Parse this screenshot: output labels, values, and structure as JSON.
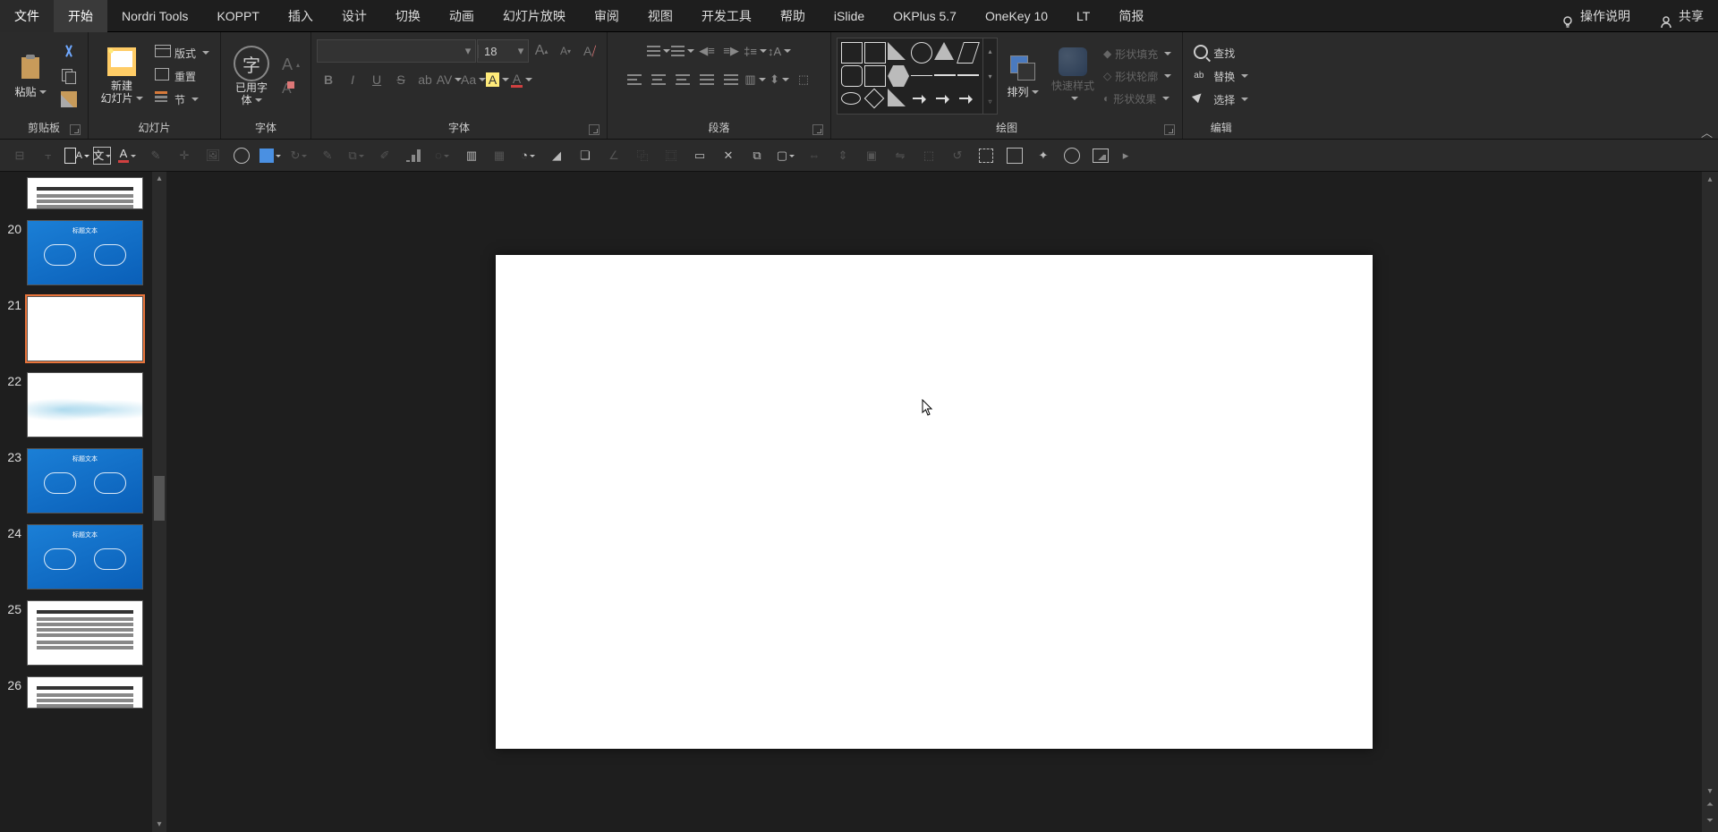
{
  "tabs": {
    "file": "文件",
    "home": "开始",
    "nordri": "Nordri Tools",
    "koppt": "KOPPT",
    "insert": "插入",
    "design": "设计",
    "transition": "切换",
    "animation": "动画",
    "slideshow": "幻灯片放映",
    "review": "审阅",
    "view": "视图",
    "dev": "开发工具",
    "help": "帮助",
    "islide": "iSlide",
    "okplus": "OKPlus 5.7",
    "onekey": "OneKey 10",
    "lt": "LT",
    "brief": "简报",
    "tell_me": "操作说明",
    "share": "共享"
  },
  "ribbon": {
    "clipboard": {
      "label": "剪贴板",
      "paste": "粘贴",
      "cut": "",
      "copy": "",
      "format_painter": ""
    },
    "slides": {
      "label": "幻灯片",
      "new_slide": "新建\n幻灯片",
      "layout": "版式",
      "reset": "重置",
      "section": "节"
    },
    "fontgrp": {
      "label": "字体",
      "used_fonts": "已用字\n体",
      "size": "18"
    },
    "paragraph": {
      "label": "段落"
    },
    "drawing": {
      "label": "绘图",
      "arrange": "排列",
      "quick_styles": "快速样式",
      "shape_fill": "形状填充",
      "shape_outline": "形状轮廓",
      "shape_effects": "形状效果"
    },
    "editing": {
      "label": "编辑",
      "find": "查找",
      "replace": "替换",
      "select": "选择"
    }
  },
  "thumbs": [
    {
      "n": "",
      "type": "text",
      "partial": true
    },
    {
      "n": "20",
      "type": "blue"
    },
    {
      "n": "21",
      "type": "blank",
      "selected": true
    },
    {
      "n": "22",
      "type": "wave"
    },
    {
      "n": "23",
      "type": "blue"
    },
    {
      "n": "24",
      "type": "blue"
    },
    {
      "n": "25",
      "type": "text"
    },
    {
      "n": "26",
      "type": "text",
      "partial": true
    }
  ]
}
